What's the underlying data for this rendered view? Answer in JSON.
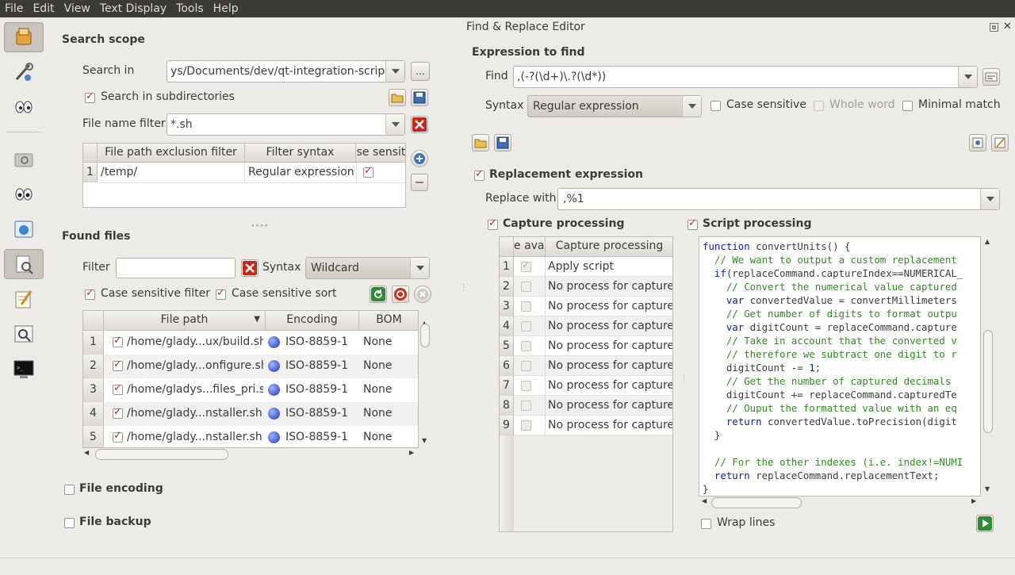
{
  "menu": [
    "File",
    "Edit",
    "View",
    "Text Display",
    "Tools",
    "Help"
  ],
  "search_scope": {
    "title": "Search scope",
    "search_in_label": "Search in",
    "search_in_value": "ys/Documents/dev/qt-integration-scripts",
    "browse_label": "...",
    "subdirs_label": "Search in subdirectories",
    "file_name_filter_label": "File name filter",
    "file_name_filter_value": "*.sh",
    "exclusion_headers": [
      "File path exclusion filter",
      "Filter syntax",
      "se sensit"
    ],
    "exclusion_rows": [
      {
        "num": "1",
        "path": "/temp/",
        "syntax": "Regular expression"
      }
    ]
  },
  "found_files": {
    "title": "Found files",
    "filter_label": "Filter",
    "filter_value": "",
    "syntax_label": "Syntax",
    "syntax_value": "Wildcard",
    "case_filter_label": "Case sensitive filter",
    "case_sort_label": "Case sensitive sort",
    "headers": [
      "File path",
      "Encoding",
      "BOM"
    ],
    "rows": [
      {
        "num": "1",
        "path": "/home/glady...ux/build.sh",
        "encoding": "ISO-8859-1",
        "bom": "None"
      },
      {
        "num": "2",
        "path": "/home/glady...onfigure.sh",
        "encoding": "ISO-8859-1",
        "bom": "None"
      },
      {
        "num": "3",
        "path": "/home/gladys...files_pri.sh",
        "encoding": "ISO-8859-1",
        "bom": "None"
      },
      {
        "num": "4",
        "path": "/home/glady...nstaller.sh",
        "encoding": "ISO-8859-1",
        "bom": "None"
      },
      {
        "num": "5",
        "path": "/home/glady...nstaller.sh",
        "encoding": "ISO-8859-1",
        "bom": "None"
      }
    ]
  },
  "file_encoding_label": "File encoding",
  "file_backup_label": "File backup",
  "editor": {
    "title": "Find & Replace Editor",
    "expression_title": "Expression to find",
    "find_label": "Find",
    "find_value": ",(-?(\\d+)\\.?(\\d*))",
    "syntax_label": "Syntax",
    "syntax_value": "Regular expression",
    "case_sensitive_label": "Case sensitive",
    "whole_word_label": "Whole word",
    "minimal_match_label": "Minimal match",
    "replacement_title": "Replacement expression",
    "replace_with_label": "Replace with",
    "replace_with_value": ",%1",
    "capture_title": "Capture processing",
    "capture_headers": [
      "e avai",
      "Capture processing"
    ],
    "capture_rows": [
      {
        "num": "1",
        "value": "Apply script"
      },
      {
        "num": "2",
        "value": "No process for capture"
      },
      {
        "num": "3",
        "value": "No process for capture"
      },
      {
        "num": "4",
        "value": "No process for capture"
      },
      {
        "num": "5",
        "value": "No process for capture"
      },
      {
        "num": "6",
        "value": "No process for capture"
      },
      {
        "num": "7",
        "value": "No process for capture"
      },
      {
        "num": "8",
        "value": "No process for capture"
      },
      {
        "num": "9",
        "value": "No process for capture"
      }
    ],
    "script_title": "Script processing",
    "script_lines": [
      "function convertUnits() {",
      "  // We want to output a custom replacement",
      "  if(replaceCommand.captureIndex==NUMERICAL_",
      "    // Convert the numerical value captured",
      "    var convertedValue = convertMillimeters",
      "    // Get number of digits to format outpu",
      "    var digitCount = replaceCommand.capture",
      "    // Take in account that the converted v",
      "    // therefore we subtract one digit to r",
      "    digitCount -= 1;",
      "    // Get the number of captured decimals",
      "    digitCount += replaceCommand.capturedTe",
      "    // Ouput the formatted value with an eq",
      "    return convertedValue.toPrecision(digit",
      "  }",
      "",
      "  // For the other indexes (i.e. index!=NUMI",
      "  return replaceCommand.replacementText;",
      "}"
    ],
    "wrap_lines_label": "Wrap lines"
  }
}
